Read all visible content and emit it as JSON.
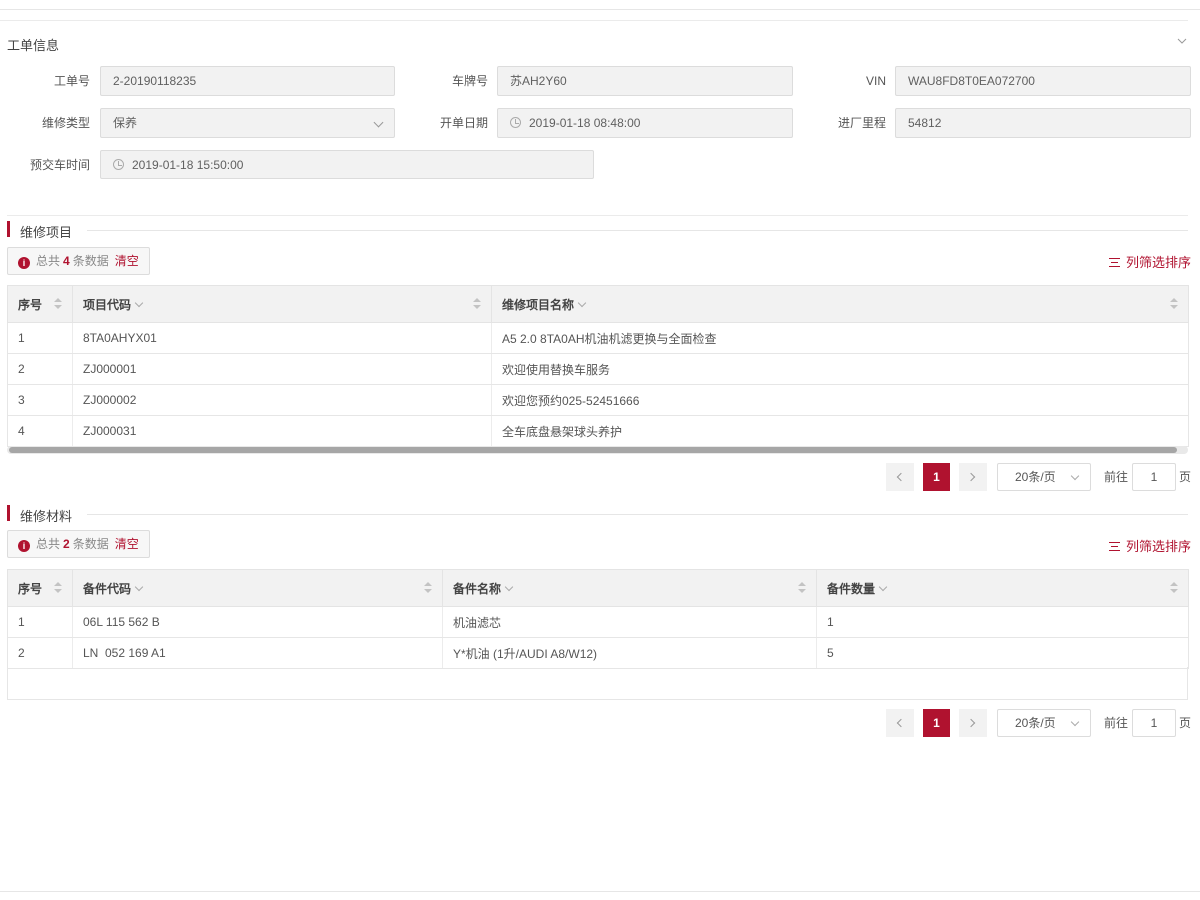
{
  "order_section": {
    "title": "工单信息",
    "fields": {
      "order_no": {
        "label": "工单号",
        "value": "2-20190118235"
      },
      "plate_no": {
        "label": "车牌号",
        "value": "苏AH2Y60"
      },
      "vin": {
        "label": "VIN",
        "value": "WAU8FD8T0EA072700"
      },
      "repair_type": {
        "label": "维修类型",
        "value": "保养"
      },
      "open_date": {
        "label": "开单日期",
        "value": "2019-01-18 08:48:00"
      },
      "mileage": {
        "label": "进厂里程",
        "value": "54812"
      },
      "delivery_time": {
        "label": "预交车时间",
        "value": "2019-01-18 15:50:00"
      }
    }
  },
  "repair_items": {
    "title": "维修项目",
    "summary": {
      "prefix": "总共",
      "count": "4",
      "suffix": "条数据",
      "clear": "清空"
    },
    "filter_label": "列筛选排序",
    "columns": [
      "序号",
      "项目代码",
      "维修项目名称"
    ],
    "rows": [
      [
        "1",
        "8TA0AHYX01",
        "A5 2.0 8TA0AH机油机滤更换与全面检查"
      ],
      [
        "2",
        "ZJ000001",
        "欢迎使用替换车服务"
      ],
      [
        "3",
        "ZJ000002",
        "欢迎您预约025-52451666"
      ],
      [
        "4",
        "ZJ000031",
        "全车底盘悬架球头养护"
      ]
    ],
    "pager": {
      "current": "1",
      "size": "20条/页",
      "goto": "前往",
      "page": "1",
      "unit": "页"
    }
  },
  "repair_materials": {
    "title": "维修材料",
    "summary": {
      "prefix": "总共",
      "count": "2",
      "suffix": "条数据",
      "clear": "清空"
    },
    "filter_label": "列筛选排序",
    "columns": [
      "序号",
      "备件代码",
      "备件名称",
      "备件数量"
    ],
    "rows": [
      [
        "1",
        "06L 115 562 B",
        "机油滤芯",
        "1"
      ],
      [
        "2",
        "LN  052 169 A1",
        "Y*机油 (1升/AUDI A8/W12)",
        "5"
      ]
    ],
    "pager": {
      "current": "1",
      "size": "20条/页",
      "goto": "前往",
      "page": "1",
      "unit": "页"
    }
  },
  "colors": {
    "accent": "#b0122f",
    "readonly_bg": "#f2f2f2",
    "header_bg": "#f2f2f2"
  }
}
